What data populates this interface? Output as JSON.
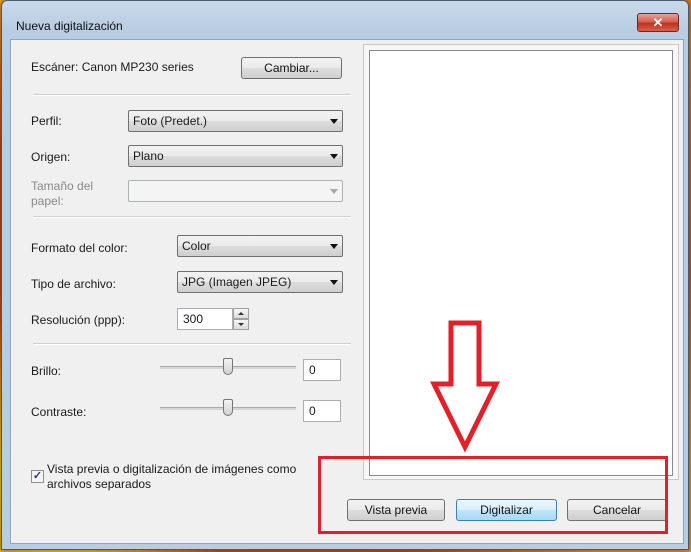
{
  "window": {
    "title": "Nueva digitalización",
    "close_glyph": "✕"
  },
  "scanner": {
    "label": "Escáner: Canon MP230 series",
    "change_button": "Cambiar..."
  },
  "profile": {
    "label": "Perfil:",
    "value": "Foto (Predet.)"
  },
  "source": {
    "label": "Origen:",
    "value": "Plano"
  },
  "paper_size": {
    "label": "Tamaño del papel:",
    "value": "",
    "disabled": true
  },
  "color_format": {
    "label": "Formato del color:",
    "value": "Color"
  },
  "file_type": {
    "label": "Tipo de archivo:",
    "value": "JPG (Imagen JPEG)"
  },
  "resolution": {
    "label": "Resolución (ppp):",
    "value": "300"
  },
  "brightness": {
    "label": "Brillo:",
    "value": "0",
    "level": 0.5
  },
  "contrast": {
    "label": "Contraste:",
    "value": "0",
    "level": 0.5
  },
  "separate_files": {
    "checked": true,
    "check_glyph": "✓",
    "label": "Vista previa o digitalización de imágenes como archivos separados"
  },
  "buttons": {
    "preview": "Vista previa",
    "scan": "Digitalizar",
    "cancel": "Cancelar"
  },
  "annotation": {
    "highlight_color": "#e3202a",
    "arrow_icon": "down-arrow-icon"
  },
  "icons": {
    "close": "close-icon",
    "dropdown": "chevron-down-icon",
    "spin_up": "spin-up-icon",
    "spin_down": "spin-down-icon"
  }
}
